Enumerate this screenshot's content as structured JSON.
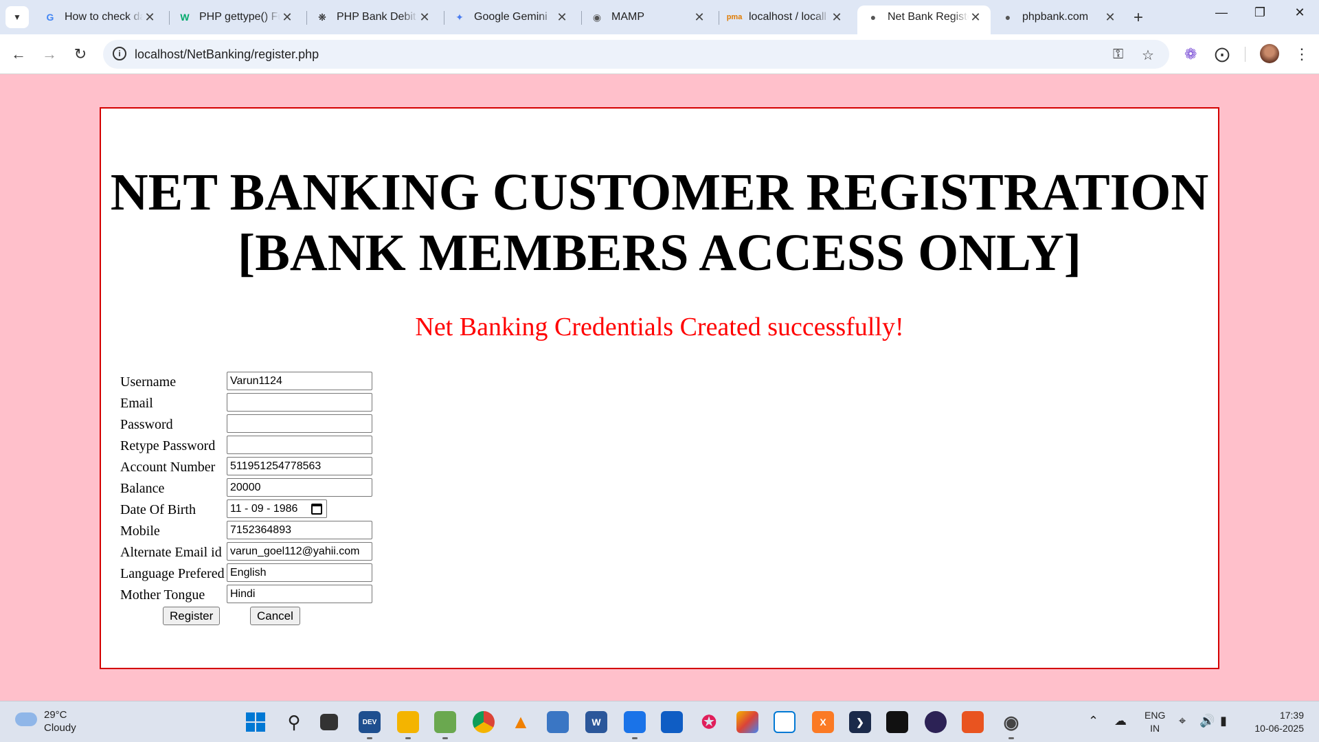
{
  "browser": {
    "tabs": [
      {
        "title": "How to check da",
        "favicon": "google-icon",
        "active": false
      },
      {
        "title": "PHP gettype() Fu",
        "favicon": "w3-icon",
        "active": false
      },
      {
        "title": "PHP Bank Debit",
        "favicon": "openai-icon",
        "active": false
      },
      {
        "title": "Google Gemini",
        "favicon": "gemini-icon",
        "active": false
      },
      {
        "title": "MAMP",
        "favicon": "mamp-icon",
        "active": false
      },
      {
        "title": "localhost / locall",
        "favicon": "phpmyadmin-icon",
        "active": false
      },
      {
        "title": "Net Bank Registe",
        "favicon": "globe-icon",
        "active": true
      },
      {
        "title": "phpbank.com",
        "favicon": "globe-icon",
        "active": false
      }
    ],
    "url": "localhost/NetBanking/register.php"
  },
  "page": {
    "heading": "NET BANKING CUSTOMER REGISTRATION [BANK MEMBERS ACCESS ONLY]",
    "success_message": "Net Banking Credentials Created successfully!",
    "form": {
      "fields": [
        {
          "label": "Username",
          "value": "Varun1124"
        },
        {
          "label": "Email",
          "value": ""
        },
        {
          "label": "Password",
          "value": ""
        },
        {
          "label": "Retype Password",
          "value": ""
        },
        {
          "label": "Account Number",
          "value": "511951254778563"
        },
        {
          "label": "Balance",
          "value": "20000"
        },
        {
          "label": "Date Of Birth",
          "value": "11 - 09 - 1986"
        },
        {
          "label": "Mobile",
          "value": "7152364893"
        },
        {
          "label": "Alternate Email id",
          "value": "varun_goel112@yahii.com"
        },
        {
          "label": "Language Prefered",
          "value": "English"
        },
        {
          "label": "Mother Tongue",
          "value": "Hindi"
        }
      ],
      "register_label": "Register",
      "cancel_label": "Cancel"
    }
  },
  "taskbar": {
    "weather_temp": "29°C",
    "weather_desc": "Cloudy",
    "lang_line1": "ENG",
    "lang_line2": "IN",
    "time": "17:39",
    "date": "10-06-2025"
  },
  "colors": {
    "page_background": "#ffc0cb",
    "panel_border": "#d40000",
    "success_text": "#ff0000"
  }
}
